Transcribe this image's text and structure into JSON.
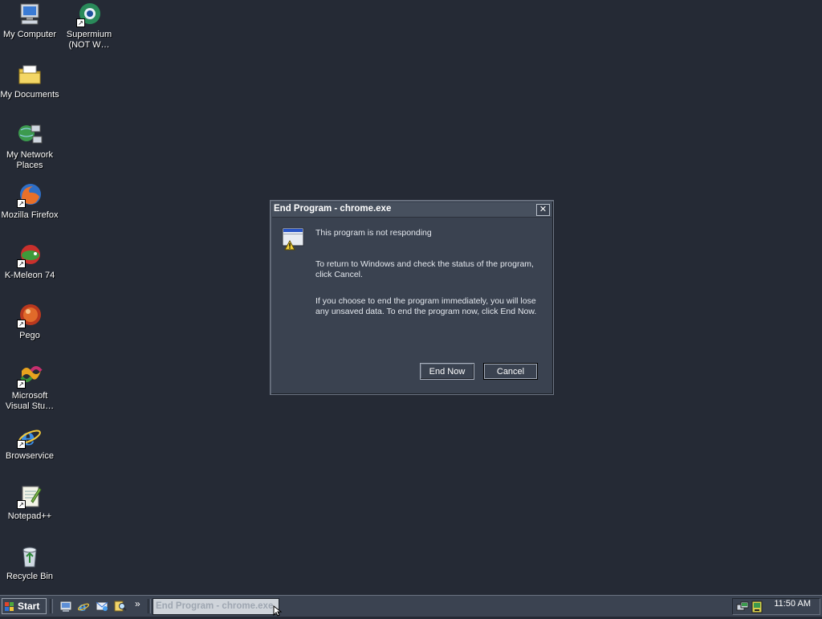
{
  "desktop": {
    "icons": [
      {
        "label": "My Computer",
        "icon": "computer-icon"
      },
      {
        "label": "Supermium\n(NOT W…",
        "icon": "supermium-icon",
        "shortcut": true
      },
      {
        "label": "My Documents",
        "icon": "folder-icon"
      },
      {
        "label": "My Network\nPlaces",
        "icon": "network-icon"
      },
      {
        "label": "Mozilla Firefox",
        "icon": "firefox-icon",
        "shortcut": true
      },
      {
        "label": "K-Meleon 74",
        "icon": "kmeleon-icon",
        "shortcut": true
      },
      {
        "label": "Pego",
        "icon": "pego-icon",
        "shortcut": true
      },
      {
        "label": "Microsoft\nVisual Stu…",
        "icon": "visual-studio-icon",
        "shortcut": true
      },
      {
        "label": "Browservice",
        "icon": "ie-icon",
        "shortcut": true
      },
      {
        "label": "Notepad++",
        "icon": "notepad-icon",
        "shortcut": true
      },
      {
        "label": "Recycle Bin",
        "icon": "recycle-bin-icon"
      }
    ],
    "shortcut_glyph": "↗"
  },
  "dialog": {
    "title": "End Program - chrome.exe",
    "close_glyph": "✕",
    "icon": "warning-window-icon",
    "message1": "This program is not responding",
    "message2": "To return to Windows and check the status of the program, click Cancel.",
    "message3": "If you choose to end the program immediately, you will lose any unsaved data. To end the program now, click End Now.",
    "end_now_label": "End Now",
    "cancel_label": "Cancel"
  },
  "taskbar": {
    "start_label": "Start",
    "quick_launch": [
      "show-desktop-icon",
      "ie-icon",
      "outlook-icon",
      "search-icon"
    ],
    "chevron": "»",
    "task_label": "End Program - chrome.exe",
    "tray_icons": [
      "network-tray-icon",
      "volume-tray-icon"
    ],
    "clock": "11:50 AM"
  },
  "colors": {
    "desktop_bg": "#252a35",
    "dialog_bg": "#3a4250",
    "taskbar_bg": "#3b4351"
  }
}
